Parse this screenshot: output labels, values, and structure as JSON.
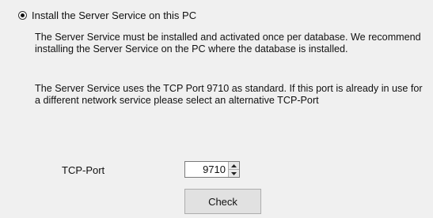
{
  "install_option": {
    "label": "Install the Server Service on this PC",
    "selected": true
  },
  "description": {
    "paragraph1": "The Server Service must be installed and activated once per database. We recommend installing the Server Service on the PC where the database is installed.",
    "paragraph2": "The Server Service uses the TCP Port 9710 as standard. If this port is already in use for a different network service please select an alternative TCP-Port"
  },
  "tcp_port": {
    "label": "TCP-Port",
    "value": "9710"
  },
  "check_button": {
    "label": "Check"
  },
  "icons": {
    "spin_up": "spin-up-arrow-icon",
    "spin_down": "spin-down-arrow-icon"
  }
}
